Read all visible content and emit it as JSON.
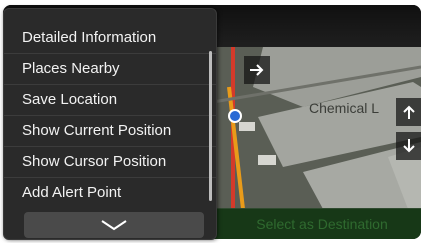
{
  "map": {
    "street_label": "Chemical L"
  },
  "menu": {
    "items": [
      {
        "label": "Detailed Information"
      },
      {
        "label": "Places Nearby"
      },
      {
        "label": "Save Location"
      },
      {
        "label": "Show Current Position"
      },
      {
        "label": "Show Cursor Position"
      },
      {
        "label": "Add Alert Point"
      }
    ],
    "more_icon": "chevron-down-icon"
  },
  "bottom_bar": {
    "destination_label": "Select as Destination"
  },
  "colors": {
    "menu_bg": "#2a2a2a",
    "map_bg": "#5a5e55",
    "bottom_bar_bg": "#173817",
    "route": "#e89b1a",
    "road_red": "#d43a2a"
  }
}
